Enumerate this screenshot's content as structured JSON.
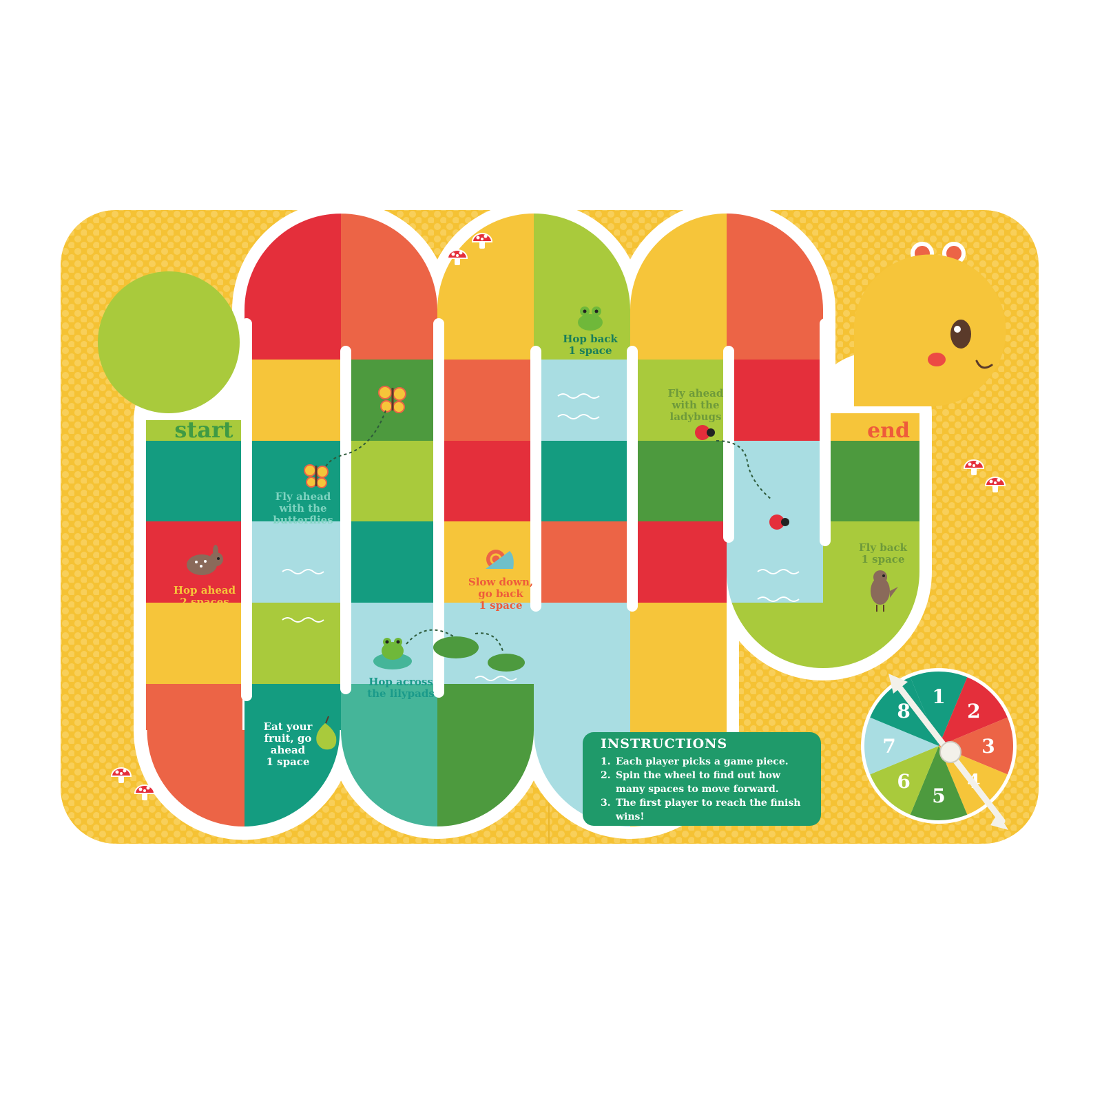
{
  "board": {
    "start_label": "start",
    "end_label": "end",
    "colors": {
      "background": "#f5c234",
      "dots": "#f8cf5a",
      "outline": "#ffffff",
      "red": "#e42f3b",
      "coral": "#ec6446",
      "yellow": "#f6c53a",
      "lime": "#a9ca3c",
      "teal": "#149c80",
      "darkgreen": "#4d9a3e",
      "aqua": "#a9dde2",
      "seafoam": "#45b599",
      "label_green": "#3f9a44",
      "label_red": "#e6343e",
      "label_coral": "#ee5b3a"
    },
    "spaces": [
      {
        "text": "Hop ahead\n2 spaces",
        "color": "#e42f3b",
        "text_color": "#f6c53a",
        "icon": "rabbit-icon"
      },
      {
        "text": "Fly ahead\nwith the\nbutterflies",
        "color": "#149c80",
        "text_color": "#7fd3c0",
        "icon": "butterfly-icon"
      },
      {
        "text": "Eat your\nfruit, go\nahead\n1 space",
        "color": "#149c80",
        "text_color": "#ffffff",
        "icon": "pear-icon"
      },
      {
        "text": "Hop across\nthe lilypads",
        "color": "#a9dde2",
        "text_color": "#1a9a8a",
        "icon": "frog-icon"
      },
      {
        "text": "Slow down,\ngo back\n1 space",
        "color": "#f6c53a",
        "text_color": "#ee5b3a",
        "icon": "snail-icon"
      },
      {
        "text": "Hop back\n1 space",
        "color": "#a9ca3c",
        "text_color": "#1a7e5a",
        "icon": "frog-icon"
      },
      {
        "text": "Fly ahead\nwith the\nladybugs",
        "color": "#a9ca3c",
        "text_color": "#6e9a3a",
        "icon": "ladybug-icon"
      },
      {
        "text": "Fly back\n1 space",
        "color": "#a9ca3c",
        "text_color": "#6e9a3a",
        "icon": "bird-icon"
      }
    ]
  },
  "instructions": {
    "title": "INSTRUCTIONS",
    "steps": [
      {
        "num": "1.",
        "text": "Each player picks a game piece."
      },
      {
        "num": "2.",
        "text": "Spin the wheel to find out how many spaces to move forward."
      },
      {
        "num": "3.",
        "text": "The first player to reach the finish wins!"
      }
    ]
  },
  "spinner": {
    "segments": [
      {
        "label": "1",
        "color": "#149c80"
      },
      {
        "label": "2",
        "color": "#e42f3b"
      },
      {
        "label": "3",
        "color": "#ec6446"
      },
      {
        "label": "4",
        "color": "#f6c53a"
      },
      {
        "label": "5",
        "color": "#4d9a3e"
      },
      {
        "label": "6",
        "color": "#a9ca3c"
      },
      {
        "label": "7",
        "color": "#a9dde2"
      },
      {
        "label": "8",
        "color": "#149c80"
      }
    ]
  }
}
